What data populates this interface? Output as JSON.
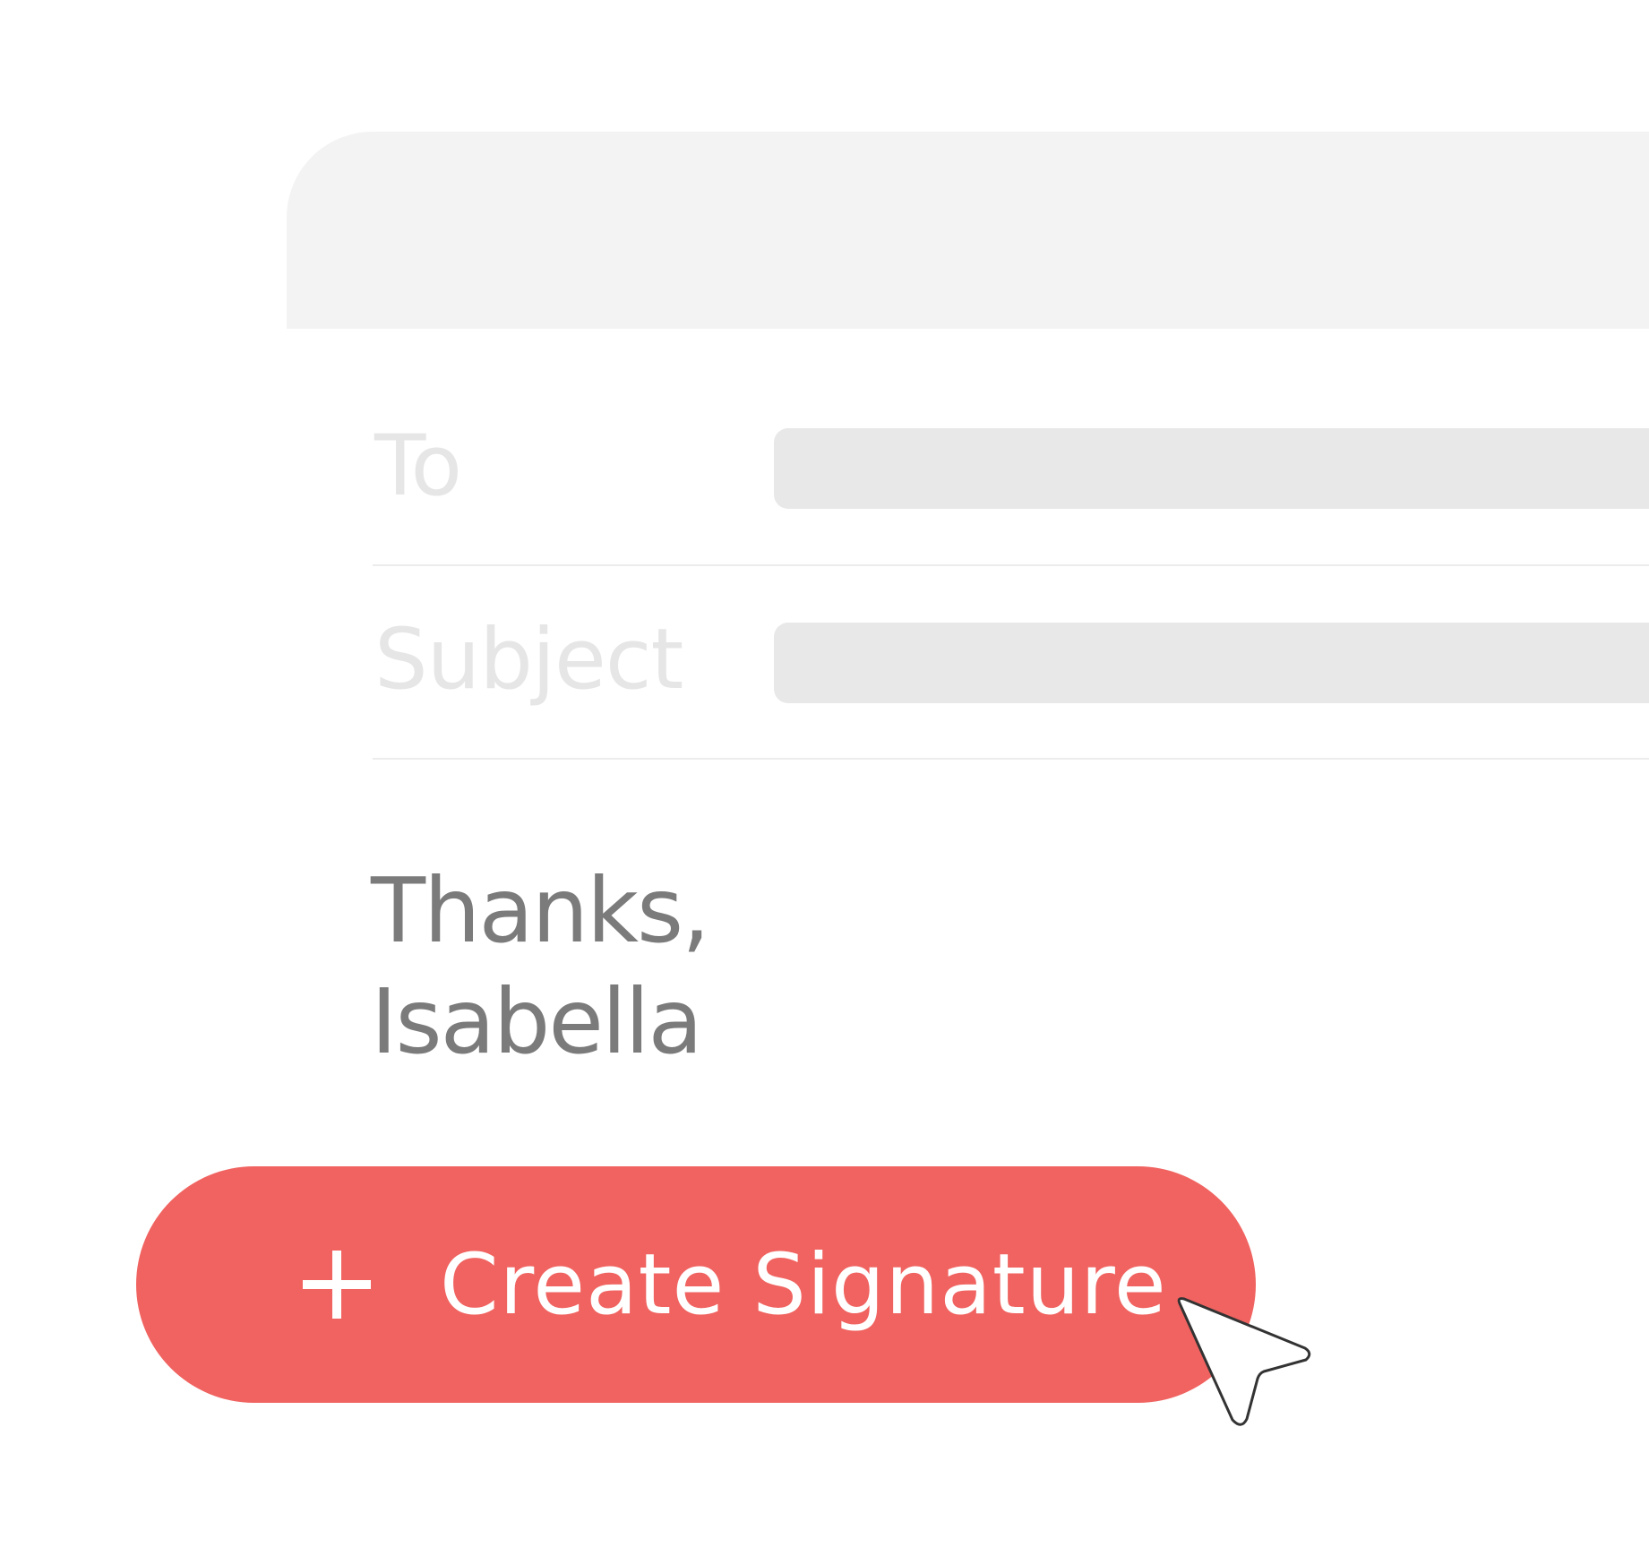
{
  "compose": {
    "to_label": "To",
    "subject_label": "Subject",
    "to_value": "",
    "subject_value": ""
  },
  "body": {
    "closing_line": "Thanks,",
    "name_line": "Isabella"
  },
  "create_button": {
    "icon": "plus-icon",
    "label": "Create Signature",
    "color": "#f06360"
  },
  "pointer": {
    "icon": "cursor-arrow-icon"
  },
  "colors": {
    "header_bg": "#f3f3f3",
    "field_bar": "#e8e8e8",
    "label_text": "#e6e6e6",
    "body_text": "#7b7b7b",
    "button_text": "#ffffff"
  }
}
